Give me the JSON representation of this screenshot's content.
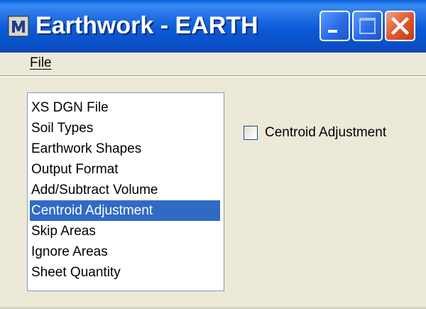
{
  "window": {
    "title": "Earthwork - EARTH",
    "app_icon": "microstation-app-icon",
    "title_bar_color": "#0a5fd8",
    "controls": {
      "minimize": "minimize-icon",
      "maximize": "maximize-icon",
      "close": "close-icon"
    }
  },
  "menu": {
    "file_label": "File"
  },
  "list": {
    "selected_color": "#316ac5",
    "items": [
      {
        "label": "XS DGN File",
        "selected": false
      },
      {
        "label": "Soil Types",
        "selected": false
      },
      {
        "label": "Earthwork Shapes",
        "selected": false
      },
      {
        "label": "Output Format",
        "selected": false
      },
      {
        "label": "Add/Subtract Volume",
        "selected": false
      },
      {
        "label": "Centroid Adjustment",
        "selected": true
      },
      {
        "label": "Skip Areas",
        "selected": false
      },
      {
        "label": "Ignore Areas",
        "selected": false
      },
      {
        "label": "Sheet Quantity",
        "selected": false
      }
    ]
  },
  "options": {
    "centroid_checkbox_label": "Centroid Adjustment",
    "centroid_checked": false
  }
}
